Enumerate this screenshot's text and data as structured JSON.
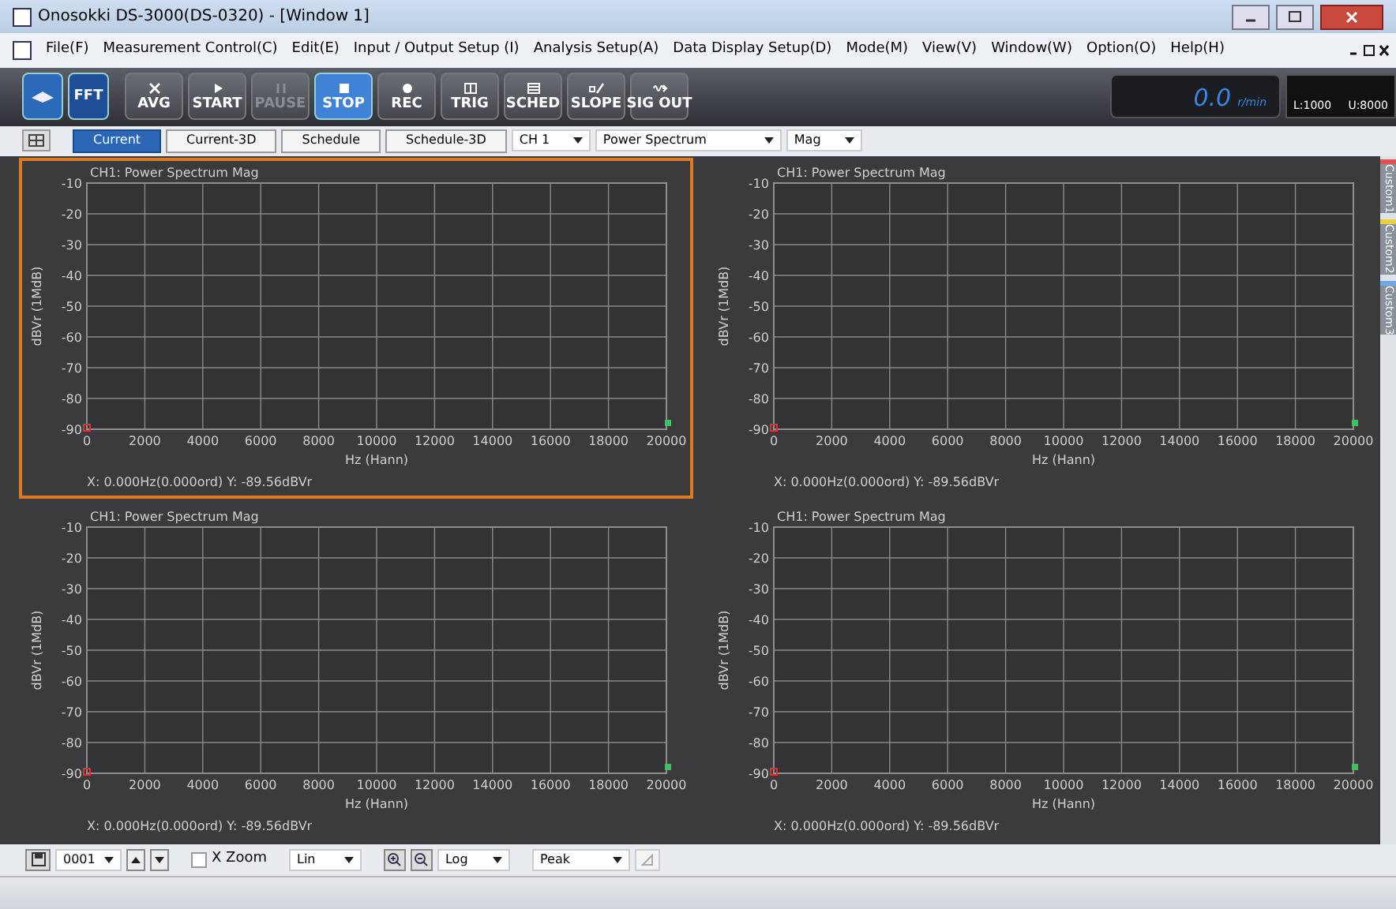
{
  "window": {
    "title": "Onosokki DS-3000(DS-0320) - [Window 1]"
  },
  "menu": [
    "File(F)",
    "Measurement Control(C)",
    "Edit(E)",
    "Input / Output Setup (I)",
    "Analysis Setup(A)",
    "Data Display Setup(D)",
    "Mode(M)",
    "View(V)",
    "Window(W)",
    "Option(O)",
    "Help(H)"
  ],
  "mode_buttons": [
    {
      "label": "FFT"
    }
  ],
  "actions": [
    {
      "label": "AVG",
      "selected": false,
      "disabled": false
    },
    {
      "label": "START",
      "selected": false,
      "disabled": false
    },
    {
      "label": "PAUSE",
      "selected": false,
      "disabled": true
    },
    {
      "label": "STOP",
      "selected": true,
      "disabled": false
    },
    {
      "label": "REC",
      "selected": false,
      "disabled": false
    },
    {
      "label": "TRIG",
      "selected": false,
      "disabled": false
    },
    {
      "label": "SCHED",
      "selected": false,
      "disabled": false
    },
    {
      "label": "SLOPE",
      "selected": false,
      "disabled": false
    },
    {
      "label": "SIG OUT",
      "selected": false,
      "disabled": false
    }
  ],
  "meter": {
    "value": "0.0",
    "unit": "r/min",
    "lower": "L:1000",
    "upper": "U:8000"
  },
  "view_tabs": [
    {
      "label": "Current",
      "selected": true
    },
    {
      "label": "Current-3D",
      "selected": false
    },
    {
      "label": "Schedule",
      "selected": false
    },
    {
      "label": "Schedule-3D",
      "selected": false
    }
  ],
  "selectors": [
    "CH 1",
    "Power Spectrum",
    "Mag"
  ],
  "panels": [
    {
      "selected": true,
      "title": "CH1: Power Spectrum Mag",
      "cursor": "X: 0.000Hz(0.000ord) Y: -89.56dBVr",
      "chart_data": {
        "type": "line",
        "xlabel": "Hz (Hann)",
        "ylabel": "dBVr (1MdB)",
        "xlim": [
          0,
          20000
        ],
        "ylim": [
          -90,
          -10
        ],
        "xticks": [
          0,
          2000,
          4000,
          6000,
          8000,
          10000,
          12000,
          14000,
          16000,
          18000,
          20000
        ],
        "yticks": [
          -10,
          -20,
          -30,
          -40,
          -50,
          -60,
          -70,
          -80,
          -90
        ],
        "grid": true
      }
    },
    {
      "selected": false,
      "title": "CH1: Power Spectrum Mag",
      "cursor": "X: 0.000Hz(0.000ord) Y: -89.56dBVr",
      "chart_data": {
        "type": "line",
        "xlabel": "Hz (Hann)",
        "ylabel": "dBVr (1MdB)",
        "xlim": [
          0,
          20000
        ],
        "ylim": [
          -90,
          -10
        ],
        "xticks": [
          0,
          2000,
          4000,
          6000,
          8000,
          10000,
          12000,
          14000,
          16000,
          18000,
          20000
        ],
        "yticks": [
          -10,
          -20,
          -30,
          -40,
          -50,
          -60,
          -70,
          -80,
          -90
        ],
        "grid": true
      }
    },
    {
      "selected": false,
      "title": "CH1: Power Spectrum Mag",
      "cursor": "X: 0.000Hz(0.000ord) Y: -89.56dBVr",
      "chart_data": {
        "type": "line",
        "xlabel": "Hz (Hann)",
        "ylabel": "dBVr (1MdB)",
        "xlim": [
          0,
          20000
        ],
        "ylim": [
          -90,
          -10
        ],
        "xticks": [
          0,
          2000,
          4000,
          6000,
          8000,
          10000,
          12000,
          14000,
          16000,
          18000,
          20000
        ],
        "yticks": [
          -10,
          -20,
          -30,
          -40,
          -50,
          -60,
          -70,
          -80,
          -90
        ],
        "grid": true
      }
    },
    {
      "selected": false,
      "title": "CH1: Power Spectrum Mag",
      "cursor": "X: 0.000Hz(0.000ord) Y: -89.56dBVr",
      "chart_data": {
        "type": "line",
        "xlabel": "Hz (Hann)",
        "ylabel": "dBVr (1MdB)",
        "xlim": [
          0,
          20000
        ],
        "ylim": [
          -90,
          -10
        ],
        "xticks": [
          0,
          2000,
          4000,
          6000,
          8000,
          10000,
          12000,
          14000,
          16000,
          18000,
          20000
        ],
        "yticks": [
          -10,
          -20,
          -30,
          -40,
          -50,
          -60,
          -70,
          -80,
          -90
        ],
        "grid": true
      }
    }
  ],
  "side_tabs": [
    {
      "label": "Custom1",
      "color": "#e05050"
    },
    {
      "label": "Custom2",
      "color": "#e8d040"
    },
    {
      "label": "Custom3",
      "color": "#70a8e8"
    }
  ],
  "bottom_bar": {
    "record": "0001",
    "x_zoom": {
      "label": "X Zoom",
      "checked": false
    },
    "x_scale": "Lin",
    "y_scale": "Log",
    "mode": "Peak"
  }
}
